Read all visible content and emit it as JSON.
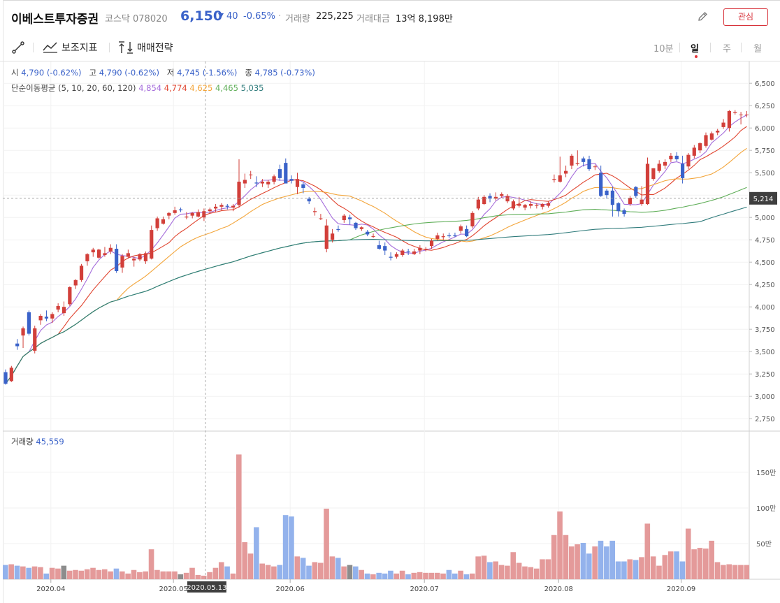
{
  "header": {
    "name": "이베스트투자증권",
    "market": "코스닥  078020",
    "price": "6,150",
    "change": "40",
    "change_pct": "-0.65%",
    "separator": "·",
    "volume_label": "거래량",
    "volume_value": "225,225",
    "amount_label": "거래대금",
    "amount_value": "13억 8,198만",
    "favorite_label": "관심"
  },
  "toolbar": {
    "draw_icon": "line-draw-icon",
    "indicator_label": "보조지표",
    "strategy_label": "매매전략",
    "periods": [
      "10분",
      "일",
      "주",
      "월"
    ],
    "active_period": "일"
  },
  "ohlc": {
    "open_label": "시",
    "open_value": "4,790 (-0.62%)",
    "high_label": "고",
    "high_value": "4,790 (-0.62%)",
    "low_label": "저",
    "low_value": "4,745 (-1.56%)",
    "close_label": "종",
    "close_value": "4,785 (-0.73%)"
  },
  "ma": {
    "label": "단순이동평균 (5, 10, 20, 60, 120)",
    "values": [
      "4,854",
      "4,774",
      "4,625",
      "4,465",
      "5,035"
    ],
    "colors": [
      "#a56ddb",
      "#e0442f",
      "#f3a53a",
      "#5fae58",
      "#2f7b7b"
    ]
  },
  "volume_panel": {
    "label": "거래량",
    "value": "45,559"
  },
  "colors": {
    "up": "#d23f3a",
    "down": "#3a62c9",
    "vol_up": "#e49a9a",
    "vol_down": "#93b2ec",
    "vol_flat": "#8c8c8c"
  },
  "crosshair": {
    "date_label": "2020.05.13",
    "price_label": "5,214"
  },
  "chart_data": [
    {
      "type": "candlestick",
      "title": "",
      "x_ticks": [
        "2020.04",
        "2020.05",
        "2020.06",
        "2020.07",
        "2020.08",
        "2020.09"
      ],
      "y_ticks": [
        "6,500",
        "6,250",
        "6,000",
        "5,750",
        "5,500",
        "5,250",
        "5,000",
        "4,750",
        "4,500",
        "4,250",
        "4,000",
        "3,750",
        "3,500",
        "3,250",
        "3,000",
        "2,750"
      ],
      "ylim": [
        2650,
        6650
      ],
      "n_days": 128,
      "candles": [
        [
          3270,
          3300,
          3130,
          3140
        ],
        [
          3170,
          3340,
          3160,
          3320
        ],
        [
          3590,
          3640,
          3520,
          3560
        ],
        [
          3680,
          3780,
          3540,
          3760
        ],
        [
          3940,
          3960,
          3680,
          3700
        ],
        [
          3510,
          3790,
          3480,
          3760
        ],
        [
          3850,
          3920,
          3800,
          3900
        ],
        [
          3890,
          3960,
          3840,
          3870
        ],
        [
          3870,
          3940,
          3820,
          3920
        ],
        [
          3970,
          4040,
          3940,
          4010
        ],
        [
          3930,
          4060,
          3900,
          4000
        ],
        [
          4030,
          4230,
          4010,
          4220
        ],
        [
          4240,
          4310,
          4200,
          4300
        ],
        [
          4300,
          4480,
          4280,
          4460
        ],
        [
          4510,
          4600,
          4460,
          4590
        ],
        [
          4610,
          4660,
          4560,
          4640
        ],
        [
          4550,
          4650,
          4540,
          4640
        ],
        [
          4580,
          4670,
          4560,
          4600
        ],
        [
          4620,
          4700,
          4590,
          4660
        ],
        [
          4650,
          4700,
          4380,
          4400
        ],
        [
          4440,
          4590,
          4380,
          4570
        ],
        [
          4560,
          4640,
          4540,
          4600
        ],
        [
          4520,
          4560,
          4450,
          4540
        ],
        [
          4530,
          4600,
          4510,
          4590
        ],
        [
          4510,
          4620,
          4480,
          4600
        ],
        [
          4540,
          4910,
          4530,
          4860
        ],
        [
          4880,
          5010,
          4850,
          4990
        ],
        [
          4930,
          5010,
          4920,
          4980
        ],
        [
          5020,
          5060,
          4980,
          5050
        ],
        [
          5050,
          5120,
          5030,
          5080
        ],
        [
          5090,
          5110,
          5060,
          5080
        ],
        [
          5000,
          5060,
          4980,
          5010
        ],
        [
          5020,
          5060,
          4990,
          5050
        ],
        [
          5010,
          5090,
          5000,
          5060
        ],
        [
          5000,
          5100,
          4960,
          5070
        ],
        [
          5070,
          5110,
          5040,
          5090
        ],
        [
          5100,
          5150,
          5060,
          5120
        ],
        [
          5120,
          5160,
          5080,
          5140
        ],
        [
          5130,
          5150,
          5090,
          5120
        ],
        [
          5110,
          5150,
          5070,
          5130
        ],
        [
          5140,
          5650,
          5110,
          5400
        ],
        [
          5380,
          5490,
          5330,
          5420
        ],
        [
          5480,
          5520,
          5430,
          5480
        ],
        [
          5390,
          5460,
          5340,
          5380
        ],
        [
          5380,
          5430,
          5340,
          5400
        ],
        [
          5370,
          5420,
          5330,
          5400
        ],
        [
          5400,
          5480,
          5370,
          5460
        ],
        [
          5540,
          5590,
          5410,
          5440
        ],
        [
          5610,
          5660,
          5380,
          5380
        ],
        [
          5430,
          5470,
          5380,
          5410
        ],
        [
          5340,
          5500,
          5260,
          5430
        ],
        [
          5370,
          5390,
          5270,
          5330
        ],
        [
          5210,
          5230,
          5150,
          5180
        ],
        [
          5060,
          5110,
          5020,
          5070
        ],
        [
          4990,
          5040,
          4970,
          4990
        ],
        [
          4650,
          4980,
          4610,
          4910
        ],
        [
          4750,
          4870,
          4720,
          4820
        ],
        [
          4870,
          4910,
          4840,
          4860
        ],
        [
          4970,
          5040,
          4940,
          5020
        ],
        [
          5000,
          5030,
          4920,
          4980
        ],
        [
          4940,
          4950,
          4860,
          4880
        ],
        [
          4870,
          4900,
          4850,
          4890
        ],
        [
          4840,
          4860,
          4790,
          4810
        ],
        [
          4790,
          4820,
          4770,
          4790
        ],
        [
          4690,
          4740,
          4640,
          4650
        ],
        [
          4680,
          4720,
          4580,
          4630
        ],
        [
          4560,
          4610,
          4520,
          4550
        ],
        [
          4560,
          4610,
          4540,
          4590
        ],
        [
          4580,
          4650,
          4560,
          4630
        ],
        [
          4620,
          4650,
          4580,
          4610
        ],
        [
          4590,
          4650,
          4580,
          4620
        ],
        [
          4630,
          4690,
          4590,
          4660
        ],
        [
          4650,
          4670,
          4620,
          4650
        ],
        [
          4680,
          4760,
          4650,
          4740
        ],
        [
          4760,
          4830,
          4740,
          4800
        ],
        [
          4780,
          4820,
          4750,
          4790
        ],
        [
          4800,
          4830,
          4770,
          4790
        ],
        [
          4800,
          4830,
          4780,
          4790
        ],
        [
          4850,
          4920,
          4820,
          4900
        ],
        [
          4870,
          4910,
          4780,
          4790
        ],
        [
          4900,
          5070,
          4880,
          5050
        ],
        [
          5100,
          5230,
          5080,
          5200
        ],
        [
          5150,
          5250,
          5140,
          5230
        ],
        [
          5240,
          5270,
          5170,
          5210
        ],
        [
          5210,
          5280,
          5190,
          5230
        ],
        [
          5240,
          5280,
          5220,
          5260
        ],
        [
          5180,
          5260,
          5160,
          5240
        ],
        [
          5100,
          5200,
          5080,
          5180
        ],
        [
          5130,
          5230,
          5110,
          5150
        ],
        [
          5110,
          5150,
          5080,
          5140
        ],
        [
          5130,
          5180,
          5100,
          5150
        ],
        [
          5130,
          5160,
          5100,
          5140
        ],
        [
          5120,
          5160,
          5090,
          5150
        ],
        [
          5130,
          5180,
          5110,
          5160
        ],
        [
          5420,
          5480,
          5390,
          5430
        ],
        [
          5400,
          5680,
          5390,
          5470
        ],
        [
          5490,
          5580,
          5450,
          5520
        ],
        [
          5580,
          5710,
          5540,
          5690
        ],
        [
          5600,
          5750,
          5580,
          5610
        ],
        [
          5660,
          5680,
          5570,
          5620
        ],
        [
          5650,
          5690,
          5520,
          5540
        ],
        [
          5570,
          5590,
          5530,
          5570
        ],
        [
          5500,
          5580,
          5230,
          5240
        ],
        [
          5300,
          5320,
          5210,
          5250
        ],
        [
          5300,
          5340,
          5010,
          5140
        ],
        [
          5160,
          5170,
          5010,
          5070
        ],
        [
          5080,
          5100,
          5010,
          5040
        ],
        [
          5150,
          5240,
          5130,
          5220
        ],
        [
          5340,
          5350,
          5220,
          5240
        ],
        [
          5150,
          5350,
          5130,
          5200
        ],
        [
          5150,
          5670,
          5140,
          5600
        ],
        [
          5430,
          5550,
          5410,
          5550
        ],
        [
          5520,
          5640,
          5500,
          5600
        ],
        [
          5580,
          5650,
          5540,
          5620
        ],
        [
          5650,
          5720,
          5620,
          5690
        ],
        [
          5690,
          5730,
          5630,
          5650
        ],
        [
          5600,
          5690,
          5380,
          5440
        ],
        [
          5570,
          5720,
          5540,
          5700
        ],
        [
          5690,
          5810,
          5660,
          5780
        ],
        [
          5750,
          5840,
          5720,
          5830
        ],
        [
          5800,
          5950,
          5780,
          5920
        ],
        [
          5870,
          5960,
          5860,
          5940
        ],
        [
          5950,
          5990,
          5920,
          5970
        ],
        [
          6010,
          6100,
          5990,
          6060
        ],
        [
          6000,
          6200,
          5960,
          6190
        ],
        [
          6170,
          6200,
          6150,
          6180
        ],
        [
          6150,
          6180,
          6040,
          6150
        ],
        [
          6150,
          6190,
          6120,
          6150
        ]
      ],
      "volume_ylim": [
        0,
        1950000
      ],
      "volume_ticks": [
        "150만",
        "100만",
        "50만"
      ],
      "volumes": [
        200000,
        210000,
        190000,
        180000,
        160000,
        180000,
        170000,
        80000,
        160000,
        150000,
        190000,
        120000,
        130000,
        120000,
        140000,
        160000,
        130000,
        140000,
        110000,
        150000,
        110000,
        80000,
        130000,
        100000,
        110000,
        420000,
        130000,
        110000,
        110000,
        110000,
        70000,
        90000,
        160000,
        60000,
        50000,
        100000,
        160000,
        240000,
        180000,
        80000,
        1750000,
        520000,
        360000,
        730000,
        220000,
        200000,
        180000,
        200000,
        900000,
        880000,
        320000,
        300000,
        190000,
        240000,
        230000,
        990000,
        320000,
        300000,
        180000,
        200000,
        180000,
        130000,
        80000,
        70000,
        90000,
        80000,
        120000,
        80000,
        120000,
        70000,
        90000,
        100000,
        90000,
        90000,
        90000,
        80000,
        130000,
        80000,
        120000,
        70000,
        80000,
        320000,
        330000,
        240000,
        250000,
        200000,
        190000,
        380000,
        230000,
        180000,
        170000,
        150000,
        280000,
        280000,
        620000,
        950000,
        620000,
        460000,
        490000,
        510000,
        360000,
        460000,
        540000,
        460000,
        540000,
        250000,
        250000,
        280000,
        270000,
        310000,
        780000,
        320000,
        190000,
        340000,
        390000,
        390000,
        250000,
        710000,
        420000,
        440000,
        430000,
        540000,
        240000,
        200000,
        210000,
        200000,
        200000,
        200000
      ]
    }
  ]
}
